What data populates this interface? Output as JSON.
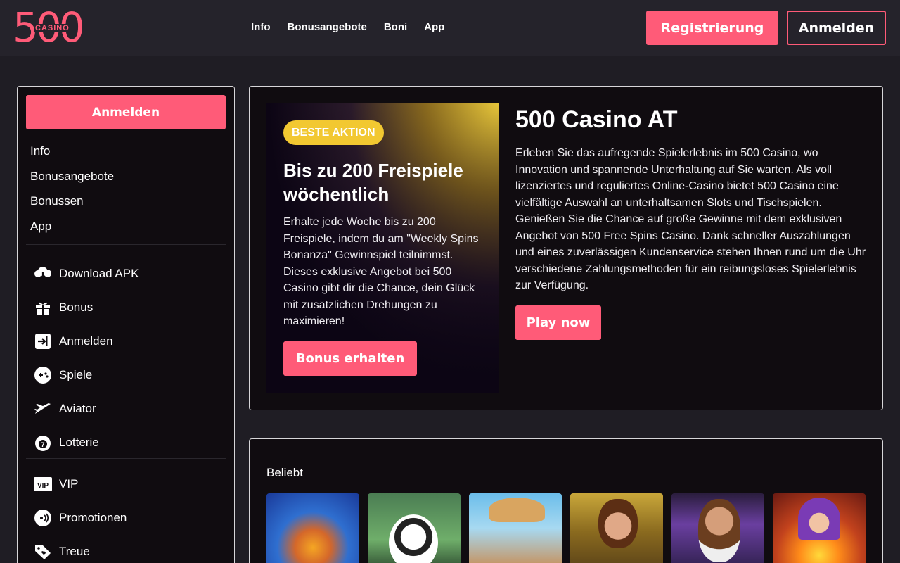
{
  "header": {
    "logo": {
      "number": "500",
      "word": "CASINO"
    },
    "nav": [
      "Info",
      "Bonusangebote",
      "Boni",
      "App"
    ],
    "register_label": "Registrierung",
    "login_label": "Anmelden"
  },
  "sidebar": {
    "login_label": "Anmelden",
    "links": [
      "Info",
      "Bonusangebote",
      "Bonussen",
      "App"
    ],
    "items": [
      {
        "label": "Download APK",
        "icon": "download-cloud-icon"
      },
      {
        "label": "Bonus",
        "icon": "gift-icon"
      },
      {
        "label": "Anmelden",
        "icon": "login-icon"
      },
      {
        "label": "Spiele",
        "icon": "gamepad-icon"
      },
      {
        "label": "Aviator",
        "icon": "plane-icon"
      },
      {
        "label": "Lotterie",
        "icon": "lottery-icon"
      }
    ],
    "items2": [
      {
        "label": "VIP",
        "icon": "vip-icon"
      },
      {
        "label": "Promotionen",
        "icon": "promotions-icon"
      },
      {
        "label": "Treue",
        "icon": "loyalty-tag-icon"
      }
    ]
  },
  "promo": {
    "badge": "BESTE AKTION",
    "title": "Bis zu 200 Freispiele wöchentlich",
    "text": "Erhalte jede Woche bis zu 200 Freispiele, indem du am \"Weekly Spins Bonanza\" Gewinnspiel teilnimmst. Dieses exklusive Angebot bei 500 Casino gibt dir die Chance, dein Glück mit zusätzlichen Drehungen zu maximieren!",
    "button": "Bonus erhalten"
  },
  "hero": {
    "title": "500 Casino AT",
    "description": "Erleben Sie das aufregende Spielerlebnis im 500 Casino, wo Innovation und spannende Unterhaltung auf Sie warten. Als voll lizenziertes und reguliertes Online-Casino bietet 500 Casino eine vielfältige Auswahl an unterhaltsamen Slots und Tischspielen. Genießen Sie die Chance auf große Gewinne mit dem exklusiven Angebot von 500 Free Spins Casino. Dank schneller Auszahlungen und eines zuverlässigen Kundenservice stehen Ihnen rund um die Uhr verschiedene Zahlungsmethoden für ein reibungsloses Spielerlebnis zur Verfügung.",
    "button": "Play now"
  },
  "games": {
    "title": "Beliebt"
  },
  "colors": {
    "accent": "#ff5b78",
    "badge": "#f2c831",
    "background": "#1f1d24",
    "card": "#100c10"
  }
}
